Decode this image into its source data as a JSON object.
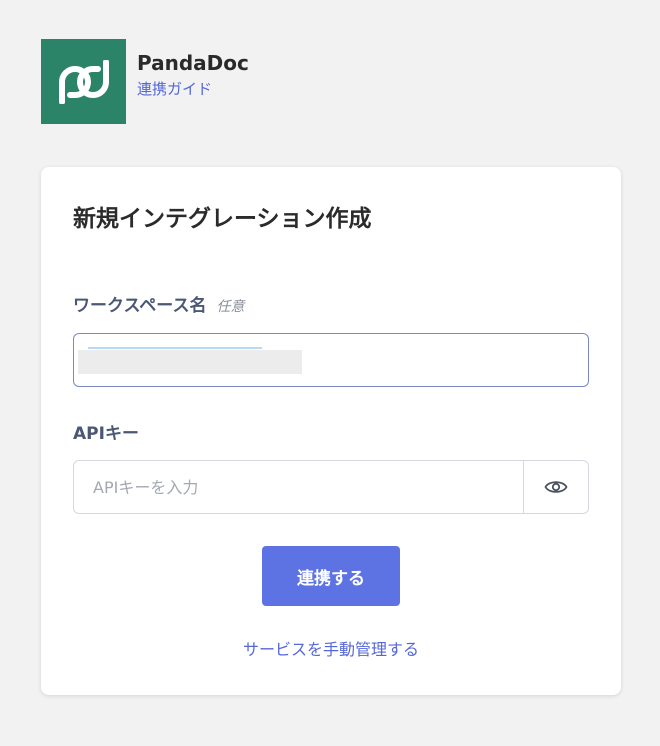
{
  "header": {
    "brand_name": "PandaDoc",
    "guide_link": "連携ガイド",
    "logo_icon": "pandadoc-logo-icon",
    "logo_color": "#2b8467"
  },
  "form": {
    "title": "新規インテグレーション作成",
    "workspace": {
      "label": "ワークスペース名",
      "optional": "任意"
    },
    "api_key": {
      "label": "APIキー",
      "placeholder": "APIキーを入力",
      "toggle_icon": "eye-icon"
    },
    "submit_label": "連携する",
    "manual_link": "サービスを手動管理する"
  },
  "colors": {
    "accent": "#5d73e3",
    "link": "#5567d8",
    "label": "#4a5875"
  }
}
